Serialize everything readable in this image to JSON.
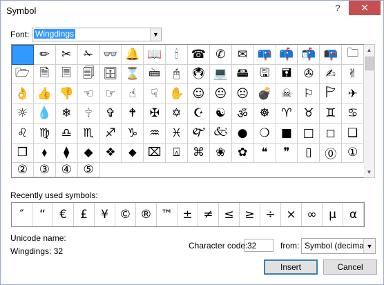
{
  "window": {
    "title": "Symbol",
    "help": "?",
    "close": "✕"
  },
  "font": {
    "label": "Font:",
    "value": "Wingdings"
  },
  "symbols": [
    " ",
    "✏",
    "✂",
    "✁",
    "👓",
    "🔔",
    "📖",
    "🕯",
    "☎",
    "✆",
    "✉",
    "📪",
    "📫",
    "📬",
    "📭",
    "🗀",
    "🗁",
    "🗎",
    "🗏",
    "🗐",
    "🗄",
    "⌛",
    "🖮",
    "🖰",
    "🖲",
    "💻",
    "🖴",
    "🖫",
    "🖬",
    "✇",
    "✍",
    "✌",
    "👌",
    "👍",
    "👎",
    "☜",
    "☞",
    "☝",
    "☟",
    "✋",
    "☺",
    "😐",
    "☹",
    "💣",
    "☠",
    "⚐",
    "🏱",
    "✈",
    "☼",
    "💧",
    "❄",
    "🕆",
    "✞",
    "🕈",
    "✠",
    "✡",
    "☪",
    "☯",
    "ॐ",
    "☸",
    "♈",
    "♉",
    "♊",
    "♋",
    "♌",
    "♍",
    "♎",
    "♏",
    "♐",
    "♑",
    "♒",
    "♓",
    "🙰",
    "🙵",
    "●",
    "❍",
    "■",
    "□",
    "◻",
    "❑",
    "❒",
    "⬧",
    "⧫",
    "◆",
    "❖",
    "⬥",
    "⌧",
    "⍓",
    "⌘",
    "❀",
    "✿",
    "❝",
    "❞",
    "▯",
    "⓪",
    "①",
    "②",
    "③",
    "④",
    "⑤"
  ],
  "recent": {
    "label": "Recently used symbols:",
    "items": [
      "″",
      "“",
      "€",
      "£",
      "¥",
      "©",
      "®",
      "™",
      "±",
      "≠",
      "≤",
      "≥",
      "÷",
      "×",
      "∞",
      "µ",
      "α"
    ]
  },
  "unicode": {
    "label": "Unicode name:",
    "value": "Wingdings: 32"
  },
  "charcode": {
    "label": "Character code:",
    "value": "32"
  },
  "from": {
    "label": "from:",
    "value": "Symbol (decimal)"
  },
  "buttons": {
    "insert": "Insert",
    "cancel": "Cancel"
  },
  "colors": {
    "selection": "#3399ff",
    "close": "#c74f50",
    "default_border": "#3c7fb1"
  }
}
